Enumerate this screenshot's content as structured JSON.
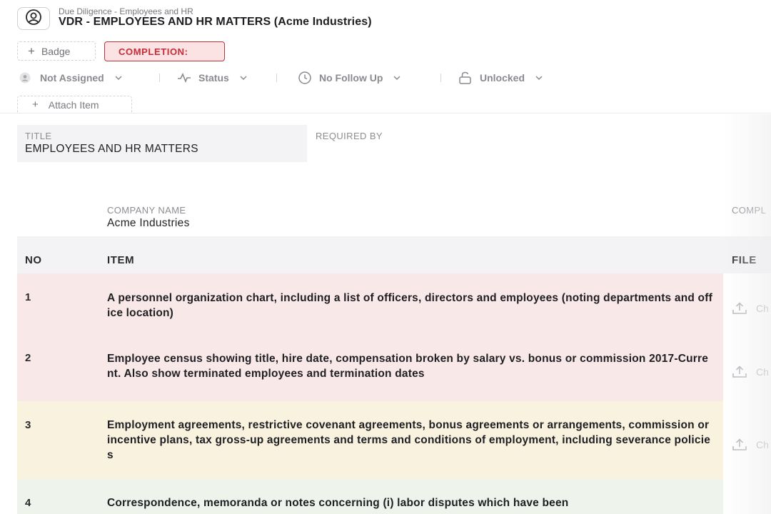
{
  "header": {
    "breadcrumb": "Due Diligence - Employees and HR",
    "title": "VDR - EMPLOYEES AND HR MATTERS (Acme Industries)",
    "icon": "user-circle-icon"
  },
  "actions": {
    "badge_label": "Badge",
    "completion_label": "COMPLETION:"
  },
  "toolbar": {
    "assignee": "Not Assigned",
    "status": "Status",
    "follow_up": "No Follow Up",
    "lock": "Unlocked"
  },
  "attach_label": "Attach Item",
  "fields": {
    "title_label": "TITLE",
    "title_value": "EMPLOYEES AND HR MATTERS",
    "required_by_label": "REQUIRED BY",
    "company_label": "COMPANY NAME",
    "company_value": "Acme Industries",
    "completion_col_label": "COMPL"
  },
  "table": {
    "columns": [
      "NO",
      "ITEM",
      "FILE"
    ],
    "file_action_label": "Ch",
    "rows": [
      {
        "no": "1",
        "item": "A personnel organization chart, including a list of officers, directors and employees (noting departments and office location)",
        "bg": "#f9e8e8"
      },
      {
        "no": "2",
        "item": "Employee census showing title, hire date, compensation broken by salary vs. bonus or commission 2017-Current.  Also show terminated employees and termination dates",
        "bg": "#f9e8e8"
      },
      {
        "no": "3",
        "item": "Employment agreements, restrictive covenant agreements, bonus agreements or arrangements, commission or incentive plans, tax gross-up agreements and terms and conditions of employment, including severance policies",
        "bg": "#f8f2df"
      },
      {
        "no": "4",
        "item": "Correspondence, memoranda or notes concerning (i) labor disputes which have been",
        "bg": "#eef3ec"
      }
    ]
  },
  "colors": {
    "completion_border": "#b8353d",
    "completion_bg": "#fbe3e4",
    "completion_text": "#c92a35"
  }
}
